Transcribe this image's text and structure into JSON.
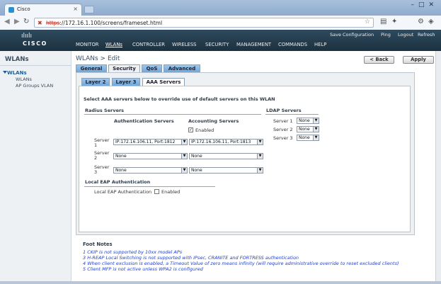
{
  "browser": {
    "tab_title": "Cisco",
    "tab_close": "×",
    "window_controls": "–□✕",
    "url_scheme": "https",
    "url_rest": "://172.16.1.100/screens/frameset.html",
    "back_glyph": "◀",
    "forward_glyph": "▶",
    "reload_glyph": "↻",
    "star_glyph": "☆"
  },
  "header": {
    "brand": "CISCO",
    "logo_bars": "ılıılı",
    "top_links": [
      "Save Configuration",
      "Ping",
      "Logout",
      "Refresh"
    ],
    "menu": [
      "MONITOR",
      "WLANs",
      "CONTROLLER",
      "WIRELESS",
      "SECURITY",
      "MANAGEMENT",
      "COMMANDS",
      "HELP"
    ],
    "active_menu": "WLANs"
  },
  "sidebar": {
    "title": "WLANs",
    "section": "WLANs",
    "items": [
      "WLANs",
      "AP Groups VLAN"
    ]
  },
  "page": {
    "title": "WLANs > Edit",
    "back_button": "< Back",
    "apply_button": "Apply",
    "tabs": [
      "General",
      "Security",
      "QoS",
      "Advanced"
    ],
    "active_tab": "Security",
    "subtabs": [
      "Layer 2",
      "Layer 3",
      "AAA Servers"
    ],
    "active_subtab": "AAA Servers"
  },
  "aaa": {
    "instruction": "Select AAA servers below to override use of default servers on this WLAN",
    "radius_heading": "Radius Servers",
    "auth_heading": "Authentication Servers",
    "acct_heading": "Accounting Servers",
    "acct_enabled_label": "Enabled",
    "acct_enabled": true,
    "server_label": "Server",
    "rows": [
      {
        "num": "1",
        "auth": "IP:172.16.106.11, Port:1812",
        "acct": "IP:172.16.106.11, Port:1813"
      },
      {
        "num": "2",
        "auth": "None",
        "acct": "None"
      },
      {
        "num": "3",
        "auth": "None",
        "acct": "None"
      }
    ],
    "ldap_heading": "LDAP Servers",
    "ldap_rows": [
      {
        "label": "Server 1",
        "value": "None"
      },
      {
        "label": "Server 2",
        "value": "None"
      },
      {
        "label": "Server 3",
        "value": "None"
      }
    ],
    "local_eap_heading": "Local EAP Authentication",
    "local_eap_label": "Local EAP Authentication",
    "local_eap_enabled_label": "Enabled",
    "local_eap_enabled": false
  },
  "footnotes": {
    "title": "Foot Notes",
    "items": [
      "1 CKIP is not supported by 10xx model APs",
      "3 H-REAP Local Switching is not supported with IPsec, CRANITE and FORTRESS authentication",
      "4 When client exclusion is enabled, a Timeout Value of zero means infinity (will require administrative override to reset excluded clients)",
      "5 Client MFP is not active unless WPA2 is configured"
    ]
  }
}
